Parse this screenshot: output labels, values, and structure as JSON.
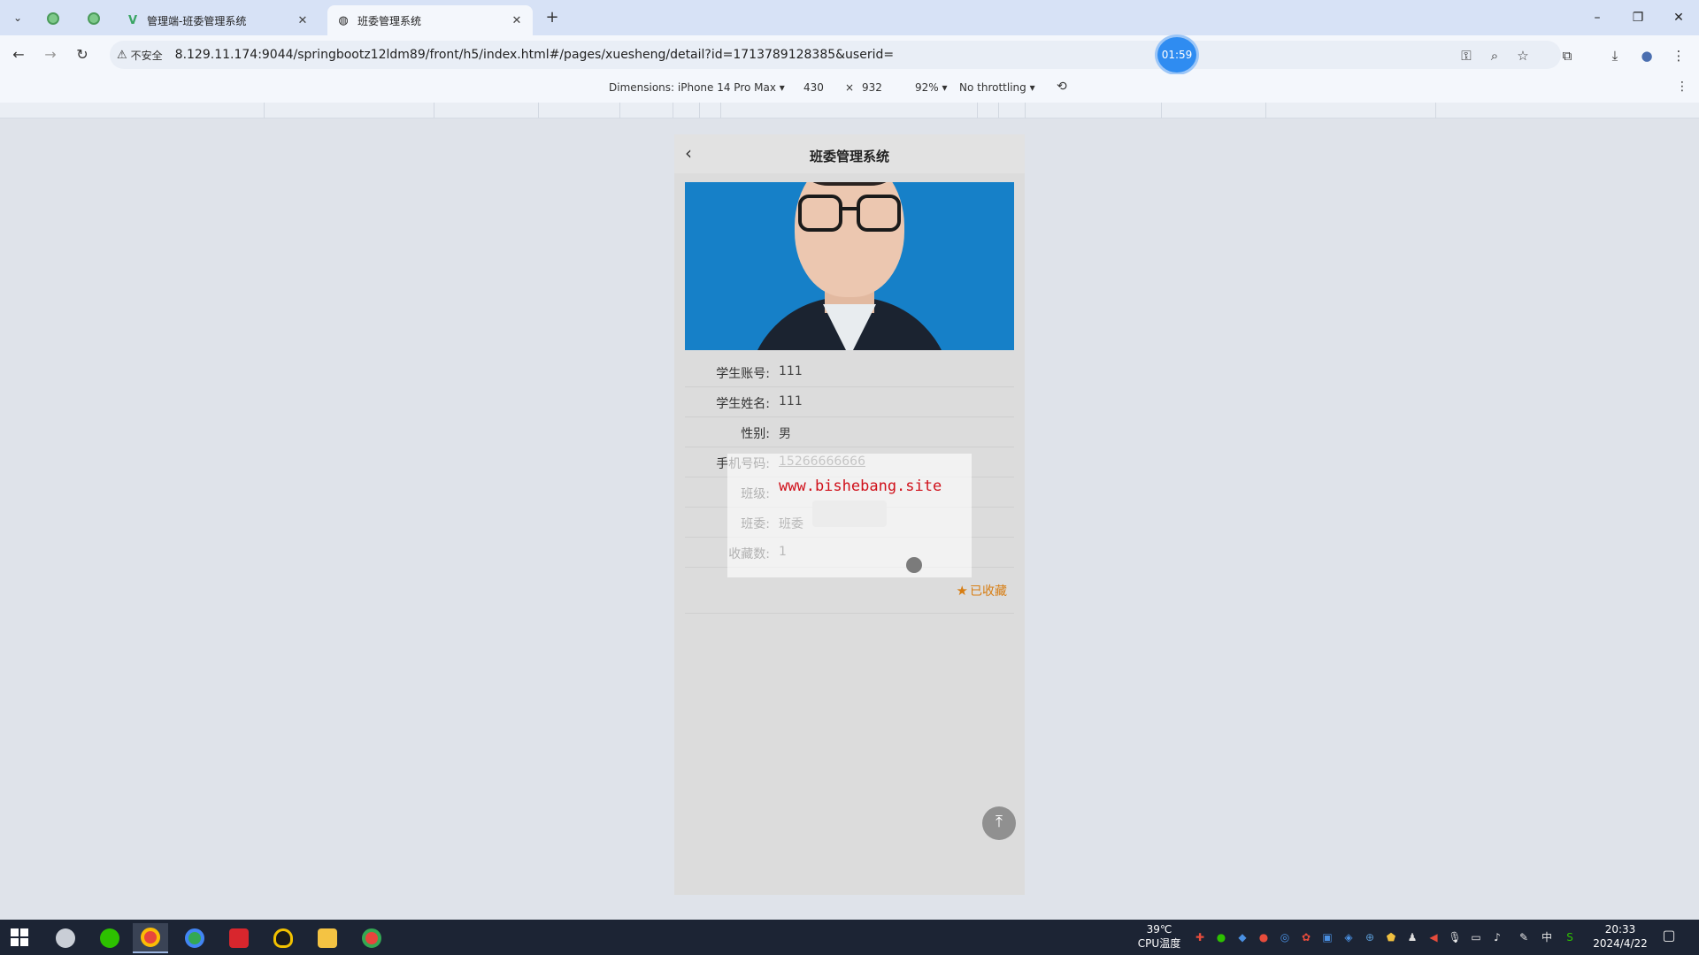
{
  "browser": {
    "tabs": [
      {
        "title": "管理端-班委管理系统",
        "active": false
      },
      {
        "title": "班委管理系统",
        "active": true
      }
    ],
    "new_tab": "+",
    "security_label": "不安全",
    "url": "8.129.11.174:9044/springbootz12ldm89/front/h5/index.html#/pages/xuesheng/detail?id=1713789128385&userid=",
    "timer": "01:59"
  },
  "devtools": {
    "dimensions_label": "Dimensions: iPhone 14 Pro Max ▾",
    "width": "430",
    "times": "×",
    "height": "932",
    "zoom": "92% ▾",
    "throttling": "No throttling ▾"
  },
  "page": {
    "title": "班委管理系统",
    "fields": [
      {
        "label": "学生账号:",
        "value": "111"
      },
      {
        "label": "学生姓名:",
        "value": "111"
      },
      {
        "label": "性别:",
        "value": "男"
      },
      {
        "label": "手机号码:",
        "value": "15266666666"
      },
      {
        "label": "班级:",
        "value": ""
      },
      {
        "label": "班委:",
        "value": "班委"
      },
      {
        "label": "收藏数:",
        "value": "1"
      }
    ],
    "favorite_label": "已收藏",
    "watermark": "www.bishebang.site"
  },
  "taskbar": {
    "temperature": "39℃",
    "cpu_label": "CPU温度",
    "ime": "中",
    "time": "20:33",
    "date": "2024/4/22"
  },
  "icons": [
    "back-icon",
    "forward-icon",
    "reload-icon",
    "warning-icon",
    "key-icon",
    "zoom-icon",
    "star-icon",
    "extensions-icon",
    "download-icon",
    "profile-icon",
    "menu-icon",
    "rotate-icon",
    "chevron-left-icon",
    "star-filled-icon",
    "arrow-up-icon",
    "windows-start-icon"
  ]
}
